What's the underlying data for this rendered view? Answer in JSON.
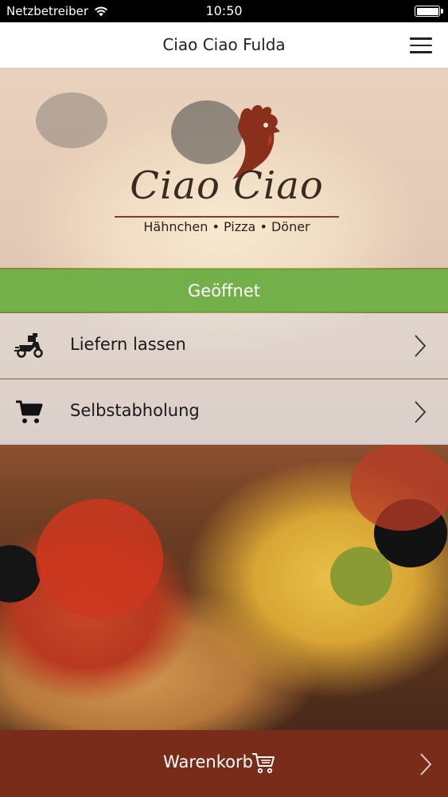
{
  "status_bar": {
    "carrier": "Netzbetreiber",
    "time": "10:50"
  },
  "navbar": {
    "title": "Ciao Ciao Fulda"
  },
  "logo": {
    "wordmark": "Ciao Ciao",
    "tagline": "Hähnchen • Pizza • Döner"
  },
  "status": {
    "label": "Geöffnet",
    "color": "#74b04a"
  },
  "options": [
    {
      "label": "Liefern lassen",
      "icon": "delivery-scooter-icon"
    },
    {
      "label": "Selbstabholung",
      "icon": "shopping-cart-icon"
    }
  ],
  "cart": {
    "label": "Warenkorb",
    "icon": "cart-outline-icon",
    "color": "#7a2c1a"
  }
}
